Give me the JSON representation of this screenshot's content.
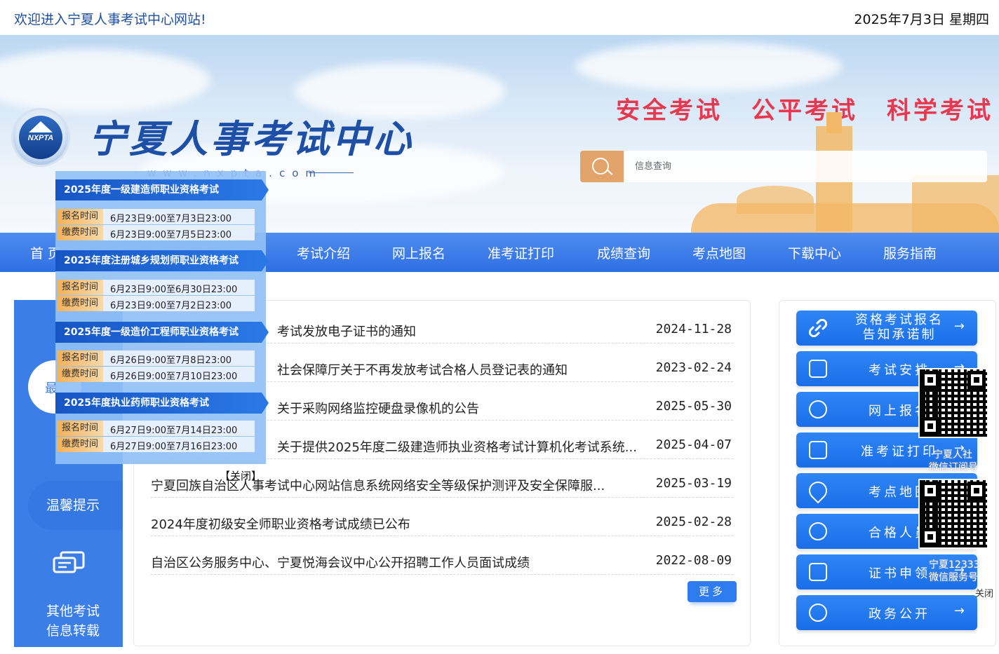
{
  "topbar": {
    "welcome": "欢迎进入宁夏人事考试中心网站!",
    "date": "2025年7月3日 星期四"
  },
  "banner": {
    "logo_text": "NXPTA",
    "site_title": "宁夏人事考试中心",
    "site_url": "www.nxpta.com",
    "slogans": [
      "安全考试",
      "公平考试",
      "科学考试"
    ],
    "search_placeholder": "信息查询"
  },
  "nav": {
    "items": [
      "首 页",
      "考试介绍",
      "网上报名",
      "准考证打印",
      "成绩查询",
      "考点地图",
      "下载中心",
      "服务指南"
    ]
  },
  "left_panel": {
    "latest_label": "最",
    "tip_label": "温馨提示",
    "other_label_line1": "其他考试",
    "other_label_line2": "信息转载"
  },
  "news": {
    "items": [
      {
        "title": "考试发放电子证书的通知",
        "date": "2024-11-28"
      },
      {
        "title": "社会保障厅关于不再发放考试合格人员登记表的通知",
        "date": "2023-02-24"
      },
      {
        "title": "关于采购网络监控硬盘录像机的公告",
        "date": "2025-05-30"
      },
      {
        "title": "关于提供2025年度二级建造师执业资格考试计算机化考试系统...",
        "date": "2025-04-07"
      },
      {
        "title": "宁夏回族自治区人事考试中心网站信息系统网络安全等级保护测评及安全保障服...",
        "date": "2025-03-19"
      },
      {
        "title": "2024年度初级安全师职业资格考试成绩已公布",
        "date": "2025-02-28"
      },
      {
        "title": "自治区公务服务中心、宁夏悦海会议中心公开招聘工作人员面试成绩",
        "date": "2022-08-09"
      }
    ],
    "more_label": "更多"
  },
  "quick_links": {
    "items": [
      {
        "line1": "资格考试报名",
        "line2": "告知承诺制"
      },
      {
        "line1": "考试安排",
        "line2": ""
      },
      {
        "line1": "网上报名",
        "line2": ""
      },
      {
        "line1": "准考证打印",
        "line2": ""
      },
      {
        "line1": "考点地图",
        "line2": ""
      },
      {
        "line1": "合格人员",
        "line2": ""
      },
      {
        "line1": "证书申领",
        "line2": ""
      },
      {
        "line1": "政务公开",
        "line2": ""
      }
    ],
    "arrow": "→"
  },
  "qr_float": {
    "caption1_line1": "宁夏人社",
    "caption1_line2": "微信订阅号",
    "caption2_line1": "宁夏12333",
    "caption2_line2": "微信服务号",
    "close_label": "关闭"
  },
  "exam_popup": {
    "exams": [
      {
        "name": "2025年度一级建造师职业资格考试",
        "reg_label": "报名时间",
        "reg": "6月23日9:00至7月3日23:00",
        "pay_label": "缴费时间",
        "pay": "6月23日9:00至7月5日23:00"
      },
      {
        "name": "2025年度注册城乡规划师职业资格考试",
        "reg_label": "报名时间",
        "reg": "6月23日9:00至6月30日23:00",
        "pay_label": "缴费时间",
        "pay": "6月23日9:00至7月2日23:00"
      },
      {
        "name": "2025年度一级造价工程师职业资格考试",
        "reg_label": "报名时间",
        "reg": "6月26日9:00至7月8日23:00",
        "pay_label": "缴费时间",
        "pay": "6月26日9:00至7月10日23:00"
      },
      {
        "name": "2025年度执业药师职业资格考试",
        "reg_label": "报名时间",
        "reg": "6月27日9:00至7月14日23:00",
        "pay_label": "缴费时间",
        "pay": "6月27日9:00至7月16日23:00"
      }
    ],
    "close_label": "【关闭】"
  },
  "colors": {
    "brand_blue": "#2f6fe4",
    "slogan_red": "#e8384f",
    "search_orange": "#e3a46c",
    "label_orange": "#f2b15b"
  }
}
